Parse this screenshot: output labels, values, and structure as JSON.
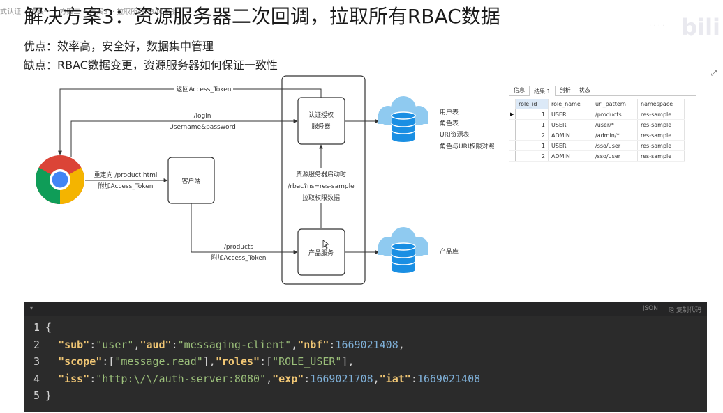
{
  "page": {
    "top_strip_text": "式认证 ·· 方案一 ·· 方案二 ·· 方案3 ·· 拉取所有RBAC数据",
    "title": "解决方案3：资源服务器二次回调，拉取所有RBAC数据",
    "pros": "优点：效率高，安全好，数据集中管理",
    "cons": "缺点：RBAC数据变更，资源服务器如何保证一致性",
    "brand": "bili",
    "brand_dots": "· · · ·"
  },
  "diagram": {
    "auth_server": "认证授权\n服务器",
    "client": "客户端",
    "product_service": "产品服务",
    "edge_return_token": "返回Access_Token",
    "edge_login_line1": "/login",
    "edge_login_line2": "Username&password",
    "edge_redirect_line1": "重定向 /product.html",
    "edge_redirect_line2": "附加Access_Token",
    "edge_products_line1": "/products",
    "edge_products_line2": "附加Access_Token",
    "edge_pull_line1": "资源服务器启动时",
    "edge_pull_line2": "/rbac?ns=res-sample",
    "edge_pull_line3": "拉取权限数据",
    "db1_labels": [
      "用户表",
      "角色表",
      "URI资源表",
      "角色与URI权限对照"
    ],
    "db2_label": "产品库"
  },
  "db_panel": {
    "tabs": [
      "信息",
      "结果 1",
      "剖析",
      "状态"
    ],
    "active_tab": 1,
    "columns": [
      "role_id",
      "role_name",
      "url_pattern",
      "namespace"
    ],
    "rows": [
      [
        "1",
        "USER",
        "/products",
        "res-sample"
      ],
      [
        "1",
        "USER",
        "/user/*",
        "res-sample"
      ],
      [
        "2",
        "ADMIN",
        "/admin/*",
        "res-sample"
      ],
      [
        "1",
        "USER",
        "/sso/user",
        "res-sample"
      ],
      [
        "2",
        "ADMIN",
        "/sso/user",
        "res-sample"
      ]
    ]
  },
  "code_block": {
    "language": "JSON",
    "copy_label": "复制代码",
    "line_numbers": [
      "1",
      "2",
      "3",
      "4",
      "5"
    ],
    "line1": "{",
    "sub_key": "\"sub\"",
    "sub_val": "\"user\"",
    "aud_key": "\"aud\"",
    "aud_val": "\"messaging-client\"",
    "nbf_key": "\"nbf\"",
    "nbf_val": "1669021408",
    "scope_key": "\"scope\"",
    "scope_val": "\"message.read\"",
    "roles_key": "\"roles\"",
    "roles_val": "\"ROLE_USER\"",
    "iss_key": "\"iss\"",
    "iss_val": "\"http:\\/\\/auth-server:8080\"",
    "exp_key": "\"exp\"",
    "exp_val": "1669021708",
    "iat_key": "\"iat\"",
    "iat_val": "1669021408",
    "line5": "}"
  },
  "colors": {
    "code_bg": "#2b2b2b",
    "db_blue": "#1a8fe3",
    "cloud_blue": "#8fcaf0"
  }
}
